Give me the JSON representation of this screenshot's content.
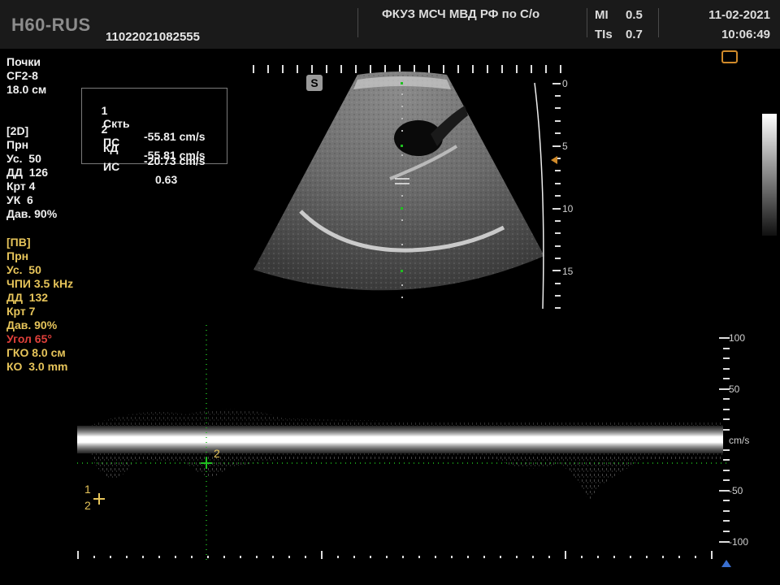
{
  "header": {
    "model": "H60-RUS",
    "patient_id": "11022021082555",
    "institution": "ФКУЗ МСЧ МВД РФ по С/о",
    "mi_label": "MI",
    "mi_value": "0.5",
    "tis_label": "TIs",
    "tis_value": "0.7",
    "date": "11-02-2021",
    "time": "10:06:49"
  },
  "left_panel": {
    "preset": "Почки",
    "probe": "CF2-8",
    "depth": "18.0 см",
    "mode_2d": "[2D]",
    "mode_2d_items": [
      "Прн",
      "Ус.  50",
      "ДД  126",
      "Крт 4",
      "УК  6",
      "Дав. 90%"
    ],
    "mode_pw": "[ПВ]",
    "mode_pw_items": [
      "Прн",
      "Ус.  50",
      "ЧПИ 3.5 kHz",
      "ДД  132",
      "Крт 7",
      "Дав. 90%"
    ],
    "angle": "Угол 65°",
    "pw_extra": [
      "ГКО 8.0 см",
      "КО  3.0 mm"
    ]
  },
  "measurements": {
    "rows": [
      {
        "idx": "1",
        "name": "Скть",
        "value": "-55.81 cm/s"
      },
      {
        "idx": "2",
        "name": "ПС",
        "value": "-55.81 cm/s"
      },
      {
        "idx": "",
        "name": "КД",
        "value": "-20.73 cm/s"
      },
      {
        "idx": "",
        "name": "ИС",
        "value": "0.63"
      }
    ]
  },
  "image": {
    "steer_marker": "S",
    "depth_scale": [
      "0",
      "5",
      "10",
      "15"
    ]
  },
  "doppler": {
    "velocity_scale": [
      "100",
      "50",
      "cm/s",
      "-50",
      "-100"
    ],
    "cursor_labels": [
      "1",
      "2",
      "2"
    ]
  },
  "colors": {
    "yellow": "#e6c45a",
    "red": "#e0403a",
    "green": "#20c020",
    "header_bg": "#1a1a1a"
  }
}
